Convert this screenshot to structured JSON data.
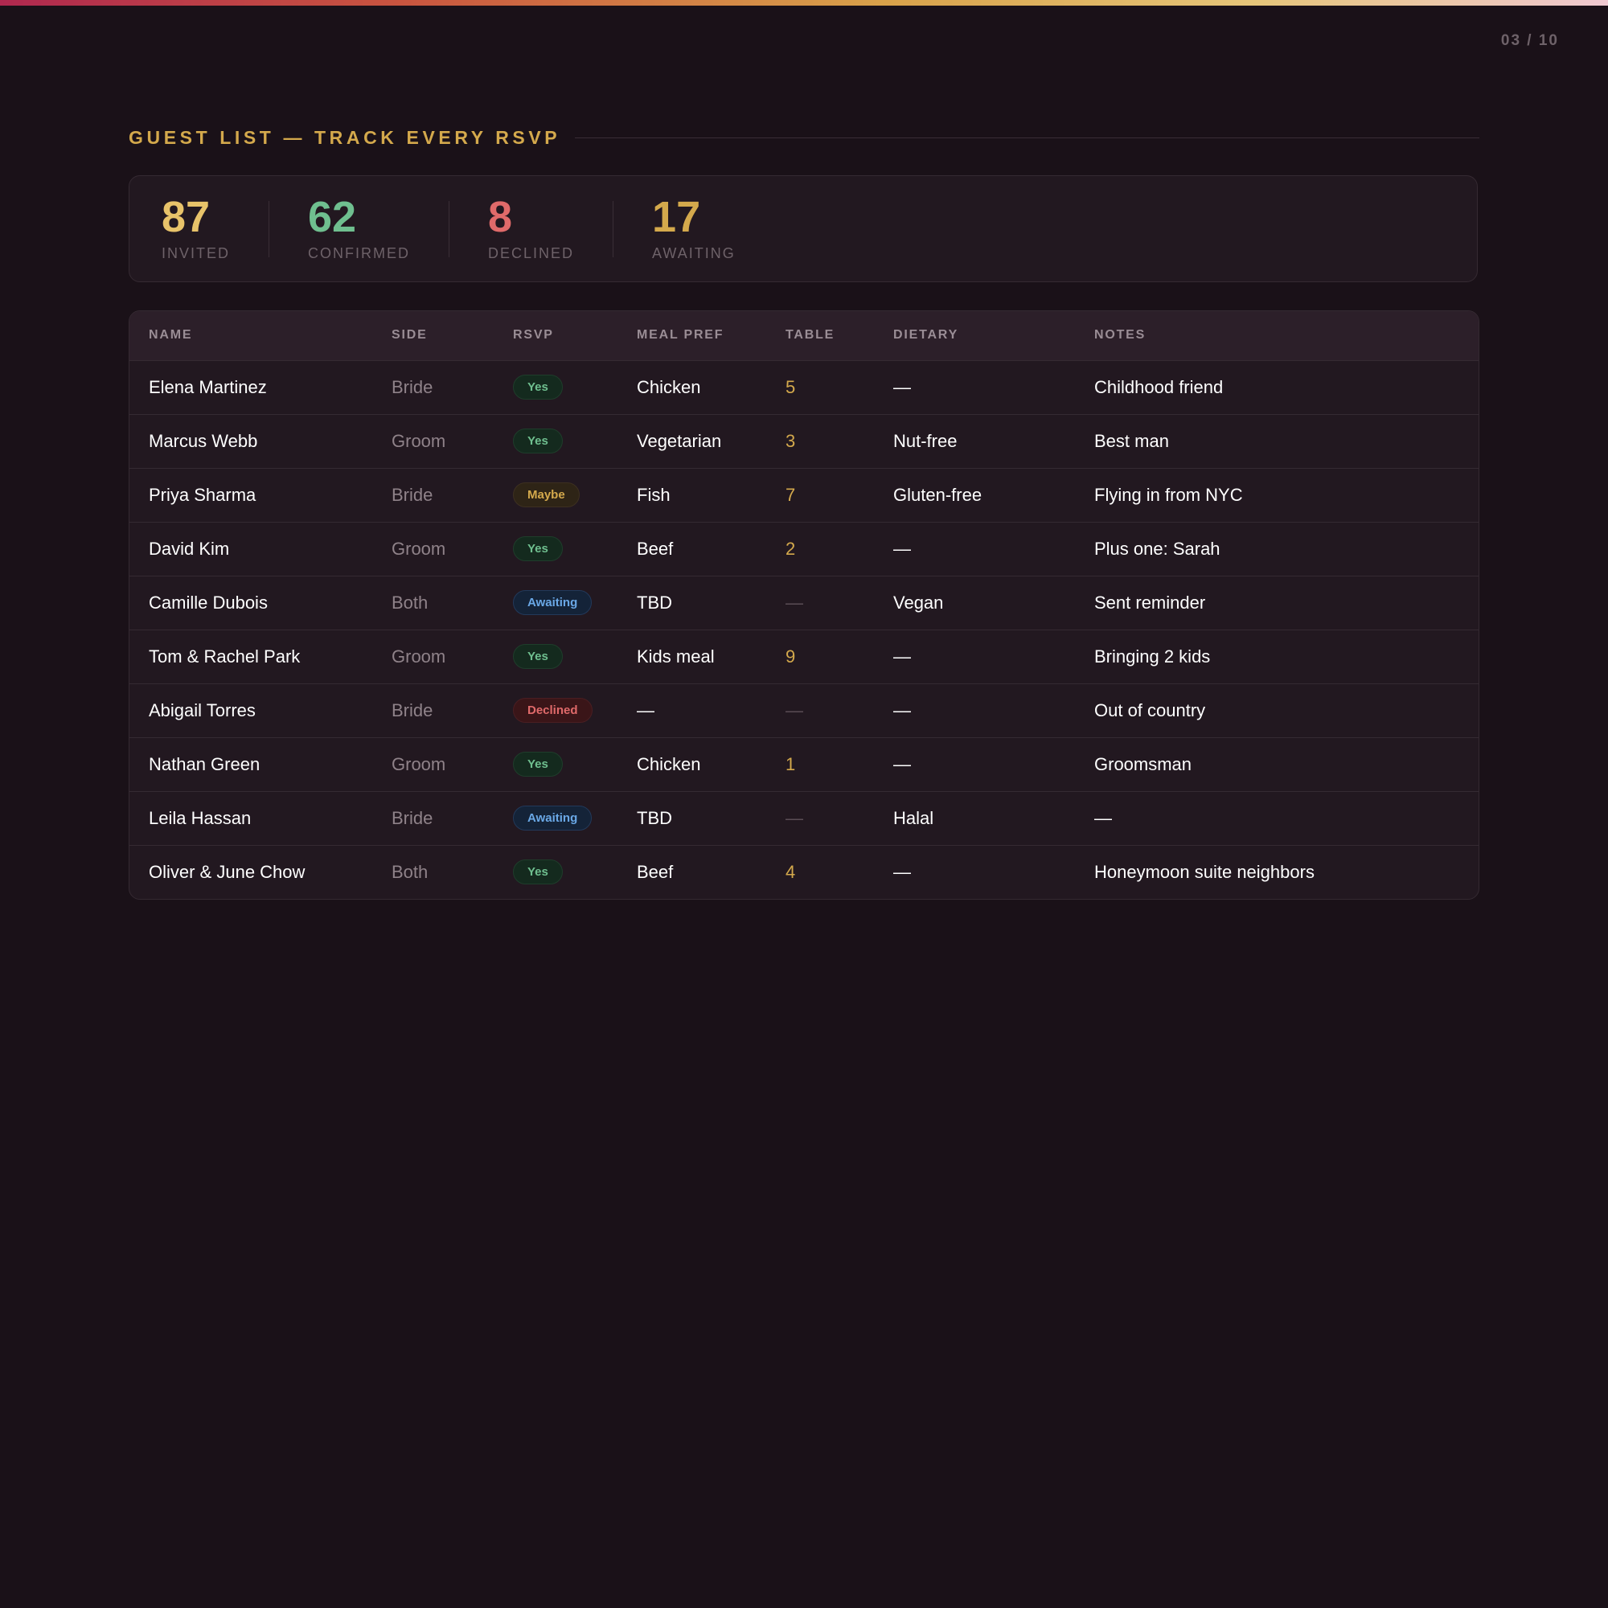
{
  "page_counter": "03 / 10",
  "section_title": "GUEST LIST — TRACK EVERY RSVP",
  "colors": {
    "gold": "#d4a94c",
    "green": "#6fbf8f",
    "red": "#e06a6a",
    "invited": "#e8c36a",
    "awaiting": "#d4a94c"
  },
  "stats": [
    {
      "number": "87",
      "label": "INVITED"
    },
    {
      "number": "62",
      "label": "CONFIRMED"
    },
    {
      "number": "8",
      "label": "DECLINED"
    },
    {
      "number": "17",
      "label": "AWAITING"
    }
  ],
  "table": {
    "headers": [
      "NAME",
      "SIDE",
      "RSVP",
      "MEAL PREF",
      "TABLE",
      "DIETARY",
      "NOTES"
    ],
    "rows": [
      {
        "name": "Elena Martinez",
        "side": "Bride",
        "rsvp": "Yes",
        "meal": "Chicken",
        "table": "5",
        "dietary": "—",
        "notes": "Childhood friend"
      },
      {
        "name": "Marcus Webb",
        "side": "Groom",
        "rsvp": "Yes",
        "meal": "Vegetarian",
        "table": "3",
        "dietary": "Nut-free",
        "notes": "Best man"
      },
      {
        "name": "Priya Sharma",
        "side": "Bride",
        "rsvp": "Maybe",
        "meal": "Fish",
        "table": "7",
        "dietary": "Gluten-free",
        "notes": "Flying in from NYC"
      },
      {
        "name": "David Kim",
        "side": "Groom",
        "rsvp": "Yes",
        "meal": "Beef",
        "table": "2",
        "dietary": "—",
        "notes": "Plus one: Sarah"
      },
      {
        "name": "Camille Dubois",
        "side": "Both",
        "rsvp": "Awaiting",
        "meal": "TBD",
        "table": "—",
        "dietary": "Vegan",
        "notes": "Sent reminder"
      },
      {
        "name": "Tom & Rachel Park",
        "side": "Groom",
        "rsvp": "Yes",
        "meal": "Kids meal",
        "table": "9",
        "dietary": "—",
        "notes": "Bringing 2 kids"
      },
      {
        "name": "Abigail Torres",
        "side": "Bride",
        "rsvp": "Declined",
        "meal": "—",
        "table": "—",
        "dietary": "—",
        "notes": "Out of country"
      },
      {
        "name": "Nathan Green",
        "side": "Groom",
        "rsvp": "Yes",
        "meal": "Chicken",
        "table": "1",
        "dietary": "—",
        "notes": "Groomsman"
      },
      {
        "name": "Leila Hassan",
        "side": "Bride",
        "rsvp": "Awaiting",
        "meal": "TBD",
        "table": "—",
        "dietary": "Halal",
        "notes": "—"
      },
      {
        "name": "Oliver & June Chow",
        "side": "Both",
        "rsvp": "Yes",
        "meal": "Beef",
        "table": "4",
        "dietary": "—",
        "notes": "Honeymoon suite neighbors"
      }
    ]
  }
}
